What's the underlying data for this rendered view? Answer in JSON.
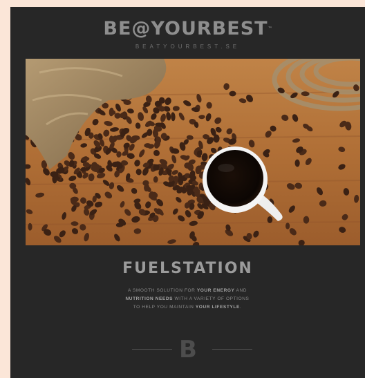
{
  "brand": {
    "logo_text": "BE@YOURBEST",
    "trademark": "™",
    "website": "BEATYOURBEST.SE"
  },
  "hero_image": {
    "subject": "coffee-beans-and-cup"
  },
  "section": {
    "title": "FUELSTATION",
    "description_lines": [
      [
        {
          "text": "A SMOOTH SOLUTION FOR ",
          "highlight": false
        },
        {
          "text": "YOUR ENERGY",
          "highlight": true
        },
        {
          "text": " AND",
          "highlight": false
        }
      ],
      [
        {
          "text": "NUTRITION NEEDS",
          "highlight": true
        },
        {
          "text": " WITH A VARIETY OF OPTIONS",
          "highlight": false
        }
      ],
      [
        {
          "text": "TO HELP YOU MAINTAIN ",
          "highlight": false
        },
        {
          "text": "YOUR LIFESTYLE",
          "highlight": true
        },
        {
          "text": ".",
          "highlight": false
        }
      ]
    ]
  },
  "footer": {
    "emblem": "B"
  },
  "colors": {
    "page_background": "#fbe6d8",
    "poster_background": "#272727",
    "logo_grey": "#8e8e8e",
    "wood": "#b8753f",
    "bean": "#3a2114"
  }
}
